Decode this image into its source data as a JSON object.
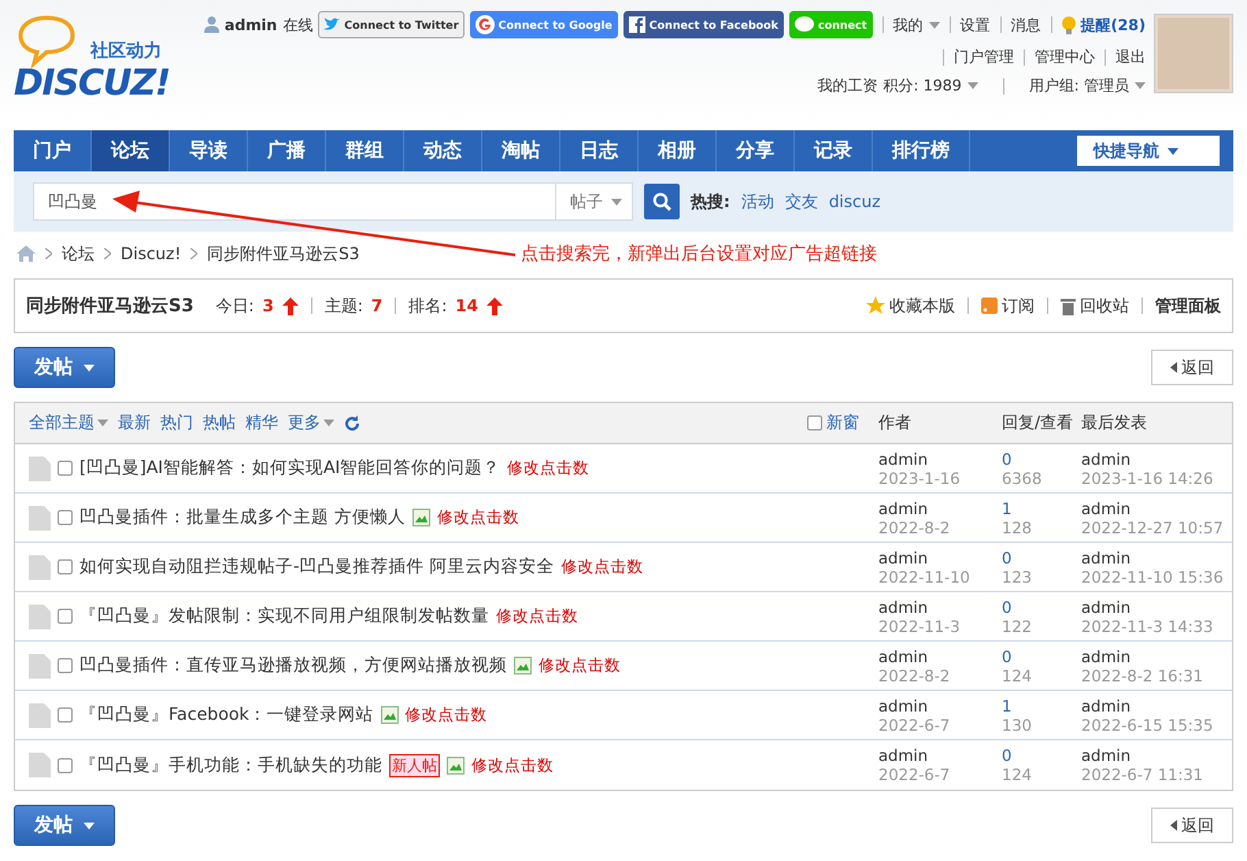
{
  "logo": {
    "tagline": "社区动力",
    "name": "DISCUZ!"
  },
  "userbar": {
    "username": "admin",
    "status": "在线",
    "connect": [
      {
        "kind": "twitter",
        "label": "Connect to Twitter"
      },
      {
        "kind": "google",
        "label": "Connect to Google"
      },
      {
        "kind": "facebook",
        "label": "Connect to Facebook"
      },
      {
        "kind": "line",
        "label": "connect"
      }
    ],
    "menu": [
      "我的",
      "设置",
      "消息"
    ],
    "reminder": "提醒(28)",
    "links": [
      "门户管理",
      "管理中心",
      "退出"
    ],
    "salary": "我的工资",
    "credits": "积分: 1989",
    "group": "用户组: 管理员"
  },
  "nav": {
    "items": [
      {
        "label": "门户",
        "selected": false
      },
      {
        "label": "论坛",
        "selected": true
      },
      {
        "label": "导读",
        "selected": false
      },
      {
        "label": "广播",
        "selected": false
      },
      {
        "label": "群组",
        "selected": false
      },
      {
        "label": "动态",
        "selected": false
      },
      {
        "label": "淘帖",
        "selected": false
      },
      {
        "label": "日志",
        "selected": false
      },
      {
        "label": "相册",
        "selected": false
      },
      {
        "label": "分享",
        "selected": false
      },
      {
        "label": "记录",
        "selected": false
      },
      {
        "label": "排行榜",
        "selected": false
      }
    ],
    "quick_nav": "快捷导航"
  },
  "search": {
    "value": "凹凸曼",
    "scope": "帖子",
    "hot_label": "热搜:",
    "hot": [
      "活动",
      "交友",
      "discuz"
    ]
  },
  "breadcrumb": [
    "论坛",
    "Discuz!",
    "同步附件亚马逊云S3"
  ],
  "annotation": "点击搜索完，新弹出后台设置对应广告超链接",
  "forum": {
    "title": "同步附件亚马逊云S3",
    "today_label": "今日:",
    "today": "3",
    "topics_label": "主题:",
    "topics": "7",
    "rank_label": "排名:",
    "rank": "14",
    "actions": [
      "收藏本版",
      "订阅",
      "回收站"
    ],
    "admin": "管理面板"
  },
  "top_actions": {
    "post": "发帖",
    "back": "返回"
  },
  "bottom_actions": {
    "post": "发帖",
    "back": "返回"
  },
  "filters": {
    "items": [
      {
        "label": "全部主题",
        "dropdown": true
      },
      {
        "label": "最新",
        "dropdown": false
      },
      {
        "label": "热门",
        "dropdown": false
      },
      {
        "label": "热帖",
        "dropdown": false
      },
      {
        "label": "精华",
        "dropdown": false
      },
      {
        "label": "更多",
        "dropdown": true
      }
    ],
    "new_window": {
      "label": "新窗",
      "checked": false
    },
    "columns": [
      "作者",
      "回复/查看",
      "最后发表"
    ]
  },
  "threads": [
    {
      "title": "[凹凸曼]AI智能解答：如何实现AI智能回答你的问题？",
      "checked": false,
      "image": false,
      "link": "修改点击数",
      "author": "admin",
      "date": "2023-1-16",
      "replies": "0",
      "views": "6368",
      "last_user": "admin",
      "last_time": "2023-1-16 14:26"
    },
    {
      "title": "凹凸曼插件：批量生成多个主题 方便懒人",
      "checked": false,
      "image": true,
      "link": "修改点击数",
      "author": "admin",
      "date": "2022-8-2",
      "replies": "1",
      "views": "128",
      "last_user": "admin",
      "last_time": "2022-12-27 10:57"
    },
    {
      "title": "如何实现自动阻拦违规帖子-凹凸曼推荐插件 阿里云内容安全",
      "checked": false,
      "image": false,
      "link": "修改点击数",
      "author": "admin",
      "date": "2022-11-10",
      "replies": "0",
      "views": "123",
      "last_user": "admin",
      "last_time": "2022-11-10 15:36"
    },
    {
      "title": "『凹凸曼』发帖限制：实现不同用户组限制发帖数量",
      "checked": false,
      "image": false,
      "link": "修改点击数",
      "author": "admin",
      "date": "2022-11-3",
      "replies": "0",
      "views": "122",
      "last_user": "admin",
      "last_time": "2022-11-3 14:33"
    },
    {
      "title": "凹凸曼插件：直传亚马逊播放视频，方便网站播放视频",
      "checked": false,
      "image": true,
      "link": "修改点击数",
      "author": "admin",
      "date": "2022-8-2",
      "replies": "0",
      "views": "124",
      "last_user": "admin",
      "last_time": "2022-8-2 16:31"
    },
    {
      "title": "『凹凸曼』Facebook：一键登录网站",
      "checked": false,
      "image": true,
      "link": "修改点击数",
      "author": "admin",
      "date": "2022-6-7",
      "replies": "1",
      "views": "130",
      "last_user": "admin",
      "last_time": "2022-6-15 15:35"
    },
    {
      "title": "『凹凸曼』手机功能：手机缺失的功能",
      "checked": false,
      "image": true,
      "new_user_badge": "新人帖",
      "link": "修改点击数",
      "author": "admin",
      "date": "2022-6-7",
      "replies": "0",
      "views": "124",
      "last_user": "admin",
      "last_time": "2022-6-7 11:31"
    }
  ]
}
